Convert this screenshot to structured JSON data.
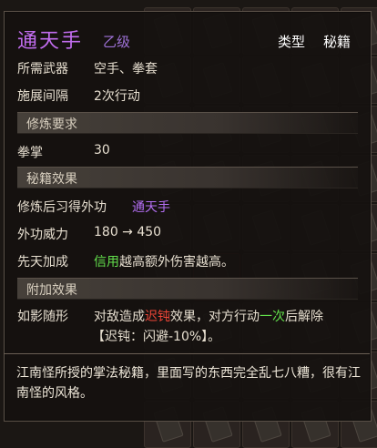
{
  "item": {
    "name": "通天手",
    "grade": "乙级",
    "type_label": "类型",
    "type_value": "秘籍"
  },
  "basic": [
    {
      "label": "所需武器",
      "value": "空手、拳套"
    },
    {
      "label": "施展间隔",
      "value": "2次行动"
    }
  ],
  "sections": {
    "requirements": "修炼要求",
    "effects": "秘籍效果",
    "extra": "附加效果"
  },
  "requirements": [
    {
      "label": "拳掌",
      "value": "30"
    }
  ],
  "effects": {
    "learn_label": "修炼后习得外功",
    "learn_value": "通天手",
    "power_label": "外功威力",
    "power_value": "180 → 450",
    "innate_label": "先天加成",
    "innate_stat": "信用",
    "innate_text": "越高额外伤害越高。"
  },
  "extra": {
    "name": "如影随形",
    "text_a": "对敌造成",
    "status": "迟钝",
    "text_b": "效果，对方行动",
    "count": "一次",
    "text_c": "后解除",
    "detail": "【迟钝：闪避-10%】。"
  },
  "description": "江南怪所授的掌法秘籍，里面写的东西完全乱七八糟，很有江南怪的风格。",
  "colors": {
    "name": "#c26df0",
    "grade": "#9f72d8",
    "green": "#63e04c",
    "red": "#f04638"
  }
}
